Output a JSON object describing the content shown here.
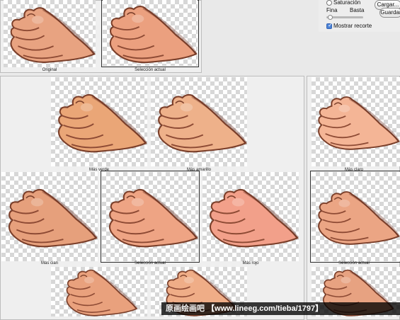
{
  "top_left": {
    "original_label": "Original",
    "current_label": "Selección actual"
  },
  "controls": {
    "saturation_label": "Saturación",
    "fine_label": "Fina",
    "coarse_label": "Basta",
    "show_clipping_label": "Mostrar recorte",
    "load_button": "Cargar...",
    "save_button": "Guardar"
  },
  "middle": {
    "more_green_label": "Más verde",
    "more_yellow_label": "Más amarillo",
    "more_cyan_label": "Más cian",
    "current_label": "Selección actual",
    "more_red_label": "Más rojo"
  },
  "right": {
    "lighter_label": "Más claro",
    "current_label": "Selección actual"
  },
  "watermark": {
    "brand": "原画绘画吧",
    "url": "【www.lineeg.com/tieba/1797】"
  },
  "colors": {
    "workspace_bg": "#e9e9e9",
    "panel_bg": "#efefef",
    "frame_border": "#333333",
    "accent_blue": "#4a82d6"
  }
}
